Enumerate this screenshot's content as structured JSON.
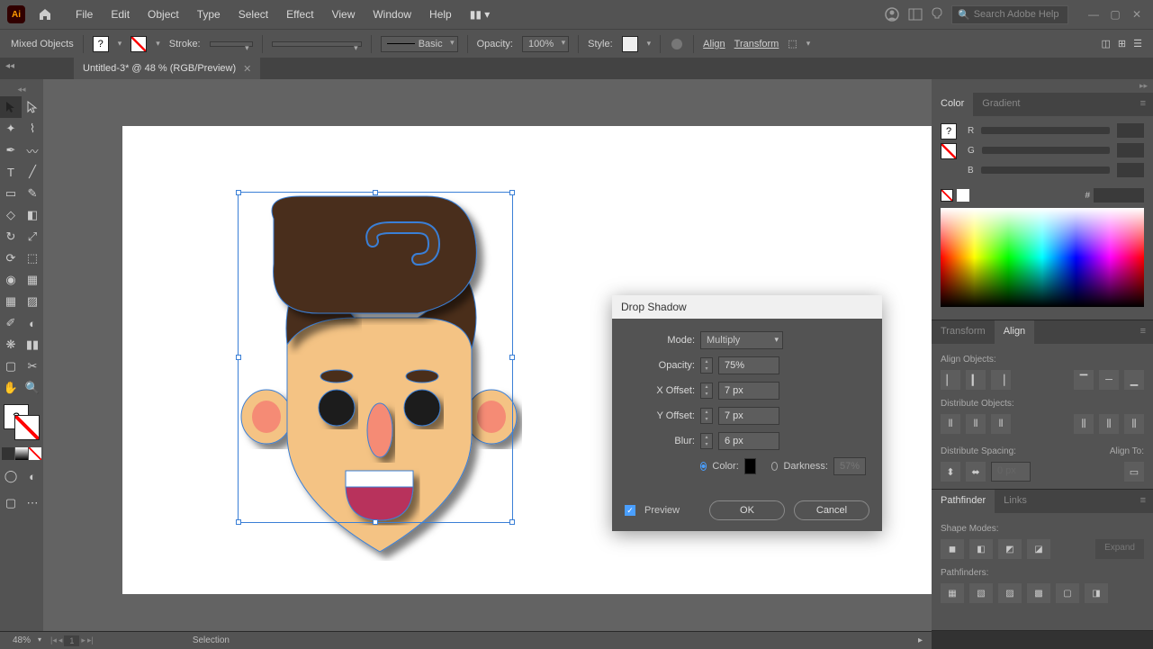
{
  "app": {
    "name": "Ai"
  },
  "menu": [
    "File",
    "Edit",
    "Object",
    "Type",
    "Select",
    "Effect",
    "View",
    "Window",
    "Help"
  ],
  "search": {
    "placeholder": "Search Adobe Help"
  },
  "control_bar": {
    "selection": "Mixed Objects",
    "stroke_label": "Stroke:",
    "style_label": "Style:",
    "basic_label": "Basic",
    "opacity_label": "Opacity:",
    "opacity_value": "100%",
    "align_label": "Align",
    "transform_label": "Transform"
  },
  "tab": {
    "title": "Untitled-3* @ 48 % (RGB/Preview)"
  },
  "dialog": {
    "title": "Drop Shadow",
    "mode_label": "Mode:",
    "mode_value": "Multiply",
    "opacity_label": "Opacity:",
    "opacity_value": "75%",
    "xoffset_label": "X Offset:",
    "xoffset_value": "7 px",
    "yoffset_label": "Y Offset:",
    "yoffset_value": "7 px",
    "blur_label": "Blur:",
    "blur_value": "6 px",
    "color_label": "Color:",
    "darkness_label": "Darkness:",
    "darkness_value": "57%",
    "preview_label": "Preview",
    "ok": "OK",
    "cancel": "Cancel"
  },
  "panels": {
    "color": {
      "tab1": "Color",
      "tab2": "Gradient",
      "r": "R",
      "g": "G",
      "b": "B",
      "hex_prefix": "#"
    },
    "transform_align": {
      "tab1": "Transform",
      "tab2": "Align",
      "align_objects": "Align Objects:",
      "distribute_objects": "Distribute Objects:",
      "distribute_spacing": "Distribute Spacing:",
      "align_to": "Align To:",
      "spacing_value": "0 px"
    },
    "pathfinder": {
      "tab1": "Pathfinder",
      "tab2": "Links",
      "shape_modes": "Shape Modes:",
      "pathfinders": "Pathfinders:",
      "expand": "Expand"
    }
  },
  "status": {
    "zoom": "48%",
    "page": "1",
    "tool": "Selection"
  }
}
